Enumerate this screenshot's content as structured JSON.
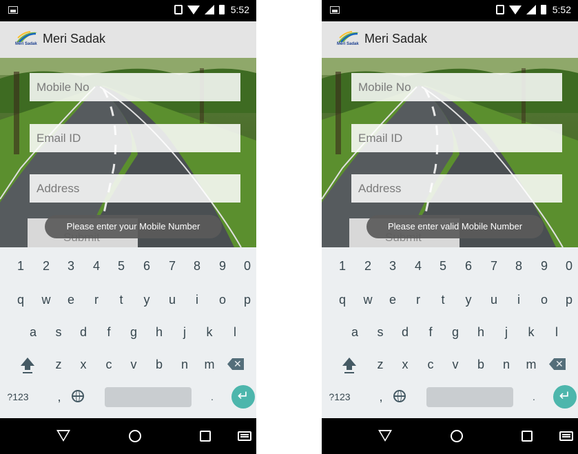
{
  "screens": [
    {
      "status_time": "5:52",
      "app_title": "Meri Sadak",
      "logo_text": "Meri Sadak",
      "fields": [
        {
          "placeholder": "Mobile No"
        },
        {
          "placeholder": "Email ID"
        },
        {
          "placeholder": "Address"
        }
      ],
      "submit_label": "Submit",
      "toast": "Please enter your Mobile Number"
    },
    {
      "status_time": "5:52",
      "app_title": "Meri Sadak",
      "logo_text": "Meri Sadak",
      "fields": [
        {
          "placeholder": "Mobile No"
        },
        {
          "placeholder": "Email ID"
        },
        {
          "placeholder": "Address"
        }
      ],
      "submit_label": "Submit",
      "toast": "Please enter valid Mobile Number"
    }
  ],
  "keyboard": {
    "number_row": [
      "1",
      "2",
      "3",
      "4",
      "5",
      "6",
      "7",
      "8",
      "9",
      "0"
    ],
    "row1": [
      "q",
      "w",
      "e",
      "r",
      "t",
      "y",
      "u",
      "i",
      "o",
      "p"
    ],
    "row2": [
      "a",
      "s",
      "d",
      "f",
      "g",
      "h",
      "j",
      "k",
      "l"
    ],
    "row3": [
      "z",
      "x",
      "c",
      "v",
      "b",
      "n",
      "m"
    ],
    "symbols_key": "?123",
    "comma_key": ",",
    "period_key": "."
  },
  "icons": {
    "notification": "image-notification-icon",
    "vibrate": "vibrate-icon",
    "wifi": "wifi-icon",
    "signal": "signal-icon",
    "battery": "battery-icon",
    "shift": "shift-icon",
    "backspace": "backspace-icon",
    "globe": "globe-icon",
    "enter": "enter-icon",
    "back": "back-icon",
    "home": "home-icon",
    "recents": "recents-icon",
    "keyboard": "keyboard-icon"
  },
  "colors": {
    "enter_key": "#4db6ac",
    "keyboard_bg": "#eceff1",
    "appbar_bg": "#e4e4e4"
  }
}
